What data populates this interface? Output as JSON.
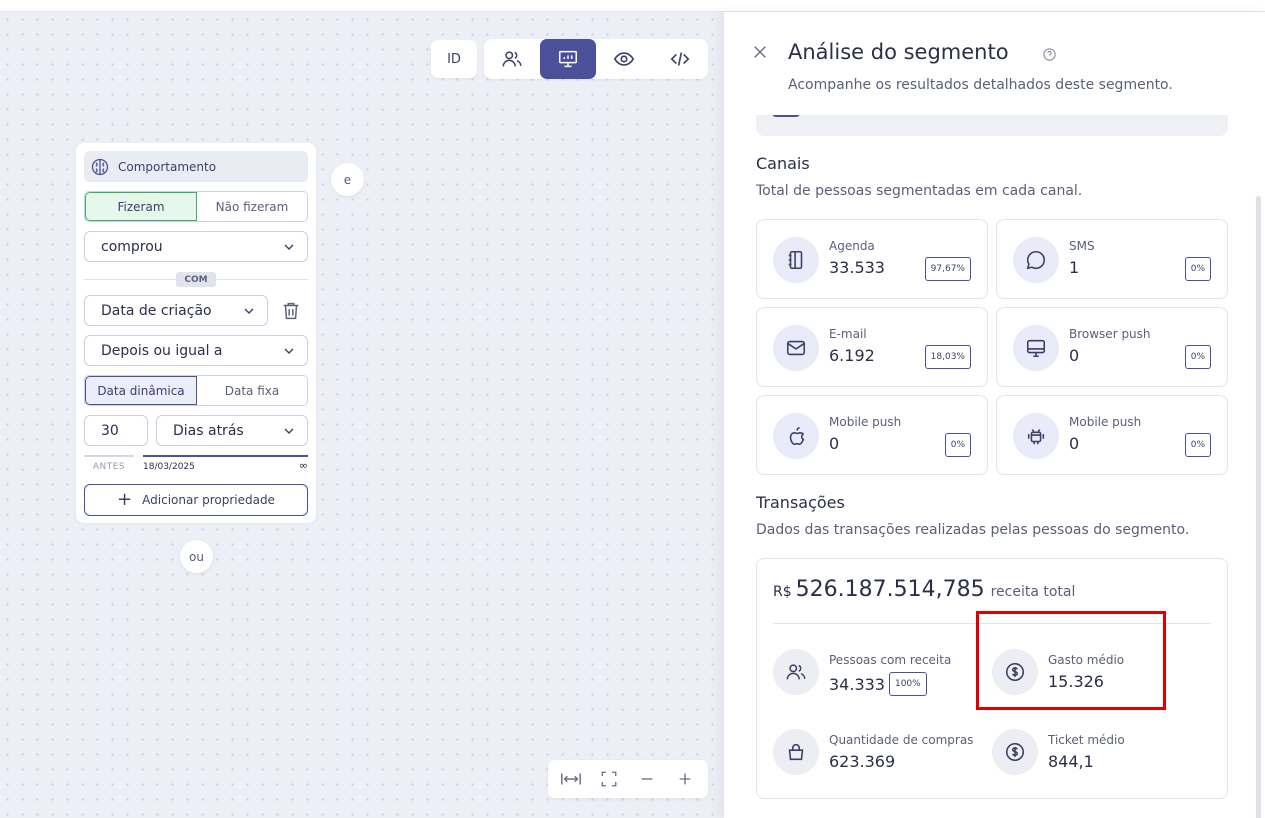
{
  "toolbar": {
    "id_label": "ID",
    "views": [
      {
        "icon": "users-icon",
        "active": false
      },
      {
        "icon": "presentation-icon",
        "active": true
      },
      {
        "icon": "eye-icon",
        "active": false
      },
      {
        "icon": "code-icon",
        "active": false
      }
    ]
  },
  "filter": {
    "header": "Comportamento",
    "toggle": {
      "did": "Fizeram",
      "did_not": "Não fizeram"
    },
    "action": "comprou",
    "with_badge": "COM",
    "property": "Data de criação",
    "operator": "Depois ou igual a",
    "date_mode": {
      "dynamic": "Data dinâmica",
      "fixed": "Data fixa"
    },
    "amount": "30",
    "unit": "Dias atrás",
    "range": {
      "before": "ANTES",
      "date": "18/03/2025",
      "infinity": "∞"
    },
    "add_property": "Adicionar propriedade"
  },
  "connectors": {
    "and": "e",
    "or": "ou"
  },
  "panel": {
    "title": "Análise do segmento",
    "subtitle": "Acompanhe os resultados detalhados deste segmento.",
    "channels": {
      "title": "Canais",
      "subtitle": "Total de pessoas segmentadas em cada canal.",
      "items": [
        {
          "name": "Agenda",
          "value": "33.533",
          "pct": "97,67%",
          "icon": "agenda-icon"
        },
        {
          "name": "SMS",
          "value": "1",
          "pct": "0%",
          "icon": "chat-icon"
        },
        {
          "name": "E-mail",
          "value": "6.192",
          "pct": "18,03%",
          "icon": "mail-icon"
        },
        {
          "name": "Browser push",
          "value": "0",
          "pct": "0%",
          "icon": "monitor-icon"
        },
        {
          "name": "Mobile push",
          "value": "0",
          "pct": "0%",
          "icon": "apple-icon"
        },
        {
          "name": "Mobile push",
          "value": "0",
          "pct": "0%",
          "icon": "android-icon"
        }
      ]
    },
    "transactions": {
      "title": "Transações",
      "subtitle": "Dados das transações realizadas pelas pessoas do segmento.",
      "currency": "R$",
      "revenue": "526.187.514,785",
      "revenue_label": "receita total",
      "items": [
        {
          "name": "Pessoas com receita",
          "value": "34.333",
          "pct": "100%",
          "icon": "users-icon"
        },
        {
          "name": "Gasto médio",
          "value": "15.326",
          "icon": "dollar-coin-icon"
        },
        {
          "name": "Quantidade de compras",
          "value": "623.369",
          "icon": "shopping-bag-icon"
        },
        {
          "name": "Ticket médio",
          "value": "844,1",
          "icon": "dollar-coin-icon"
        }
      ]
    }
  },
  "colors": {
    "accent": "#4a5099",
    "success": "#3fae6a",
    "highlight": "#e00000"
  }
}
